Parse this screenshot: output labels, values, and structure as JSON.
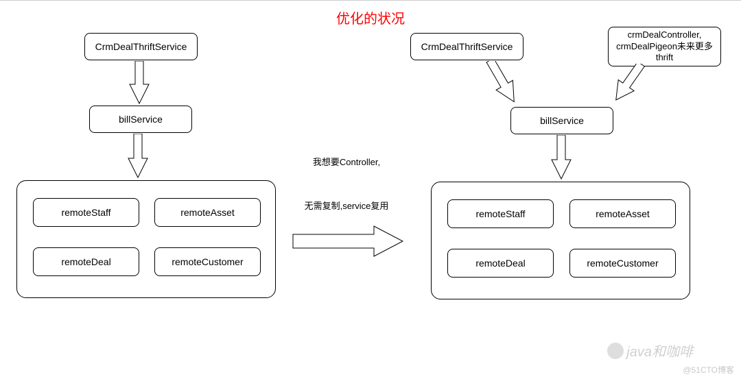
{
  "title": "优化的状况",
  "left": {
    "top_box": "CrmDealThriftService",
    "mid_box": "billService",
    "remotes": {
      "staff": "remoteStaff",
      "asset": "remoteAsset",
      "deal": "remoteDeal",
      "customer": "remoteCustomer"
    }
  },
  "right": {
    "top_box_left": "CrmDealThriftService",
    "top_box_right": "crmDealController, crmDealPigeon未来更多thrift",
    "mid_box": "billService",
    "remotes": {
      "staff": "remoteStaff",
      "asset": "remoteAsset",
      "deal": "remoteDeal",
      "customer": "remoteCustomer"
    }
  },
  "middle_text": {
    "line1": "我想要Controller,",
    "line2": "无需复制,service复用"
  },
  "watermark_wechat": "java和咖啡",
  "watermark_cto": "@51CTO博客"
}
